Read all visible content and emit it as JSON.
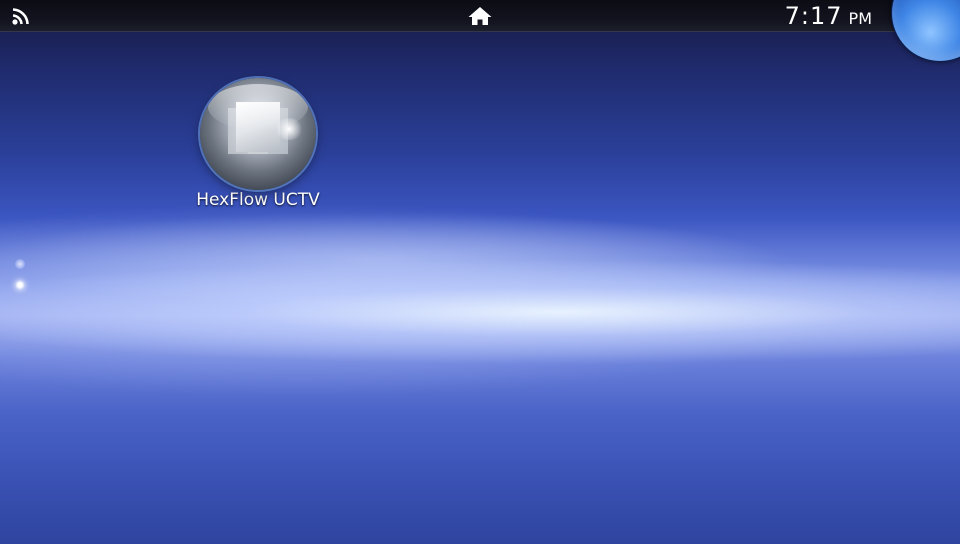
{
  "status_bar": {
    "wifi_icon": "wifi-icon",
    "home_icon": "home-icon",
    "time": "7:17",
    "ampm": "PM"
  },
  "apps": [
    {
      "label": "HexFlow UCTV",
      "icon": "cube-bubble-icon"
    }
  ],
  "page_indicator": {
    "pages": 2,
    "current_page": 2
  },
  "colors": {
    "status_bar": "#13141f",
    "background_top": "#16183f",
    "background_band": "#e6f0ff",
    "notification_bubble": "#3f86e6"
  }
}
